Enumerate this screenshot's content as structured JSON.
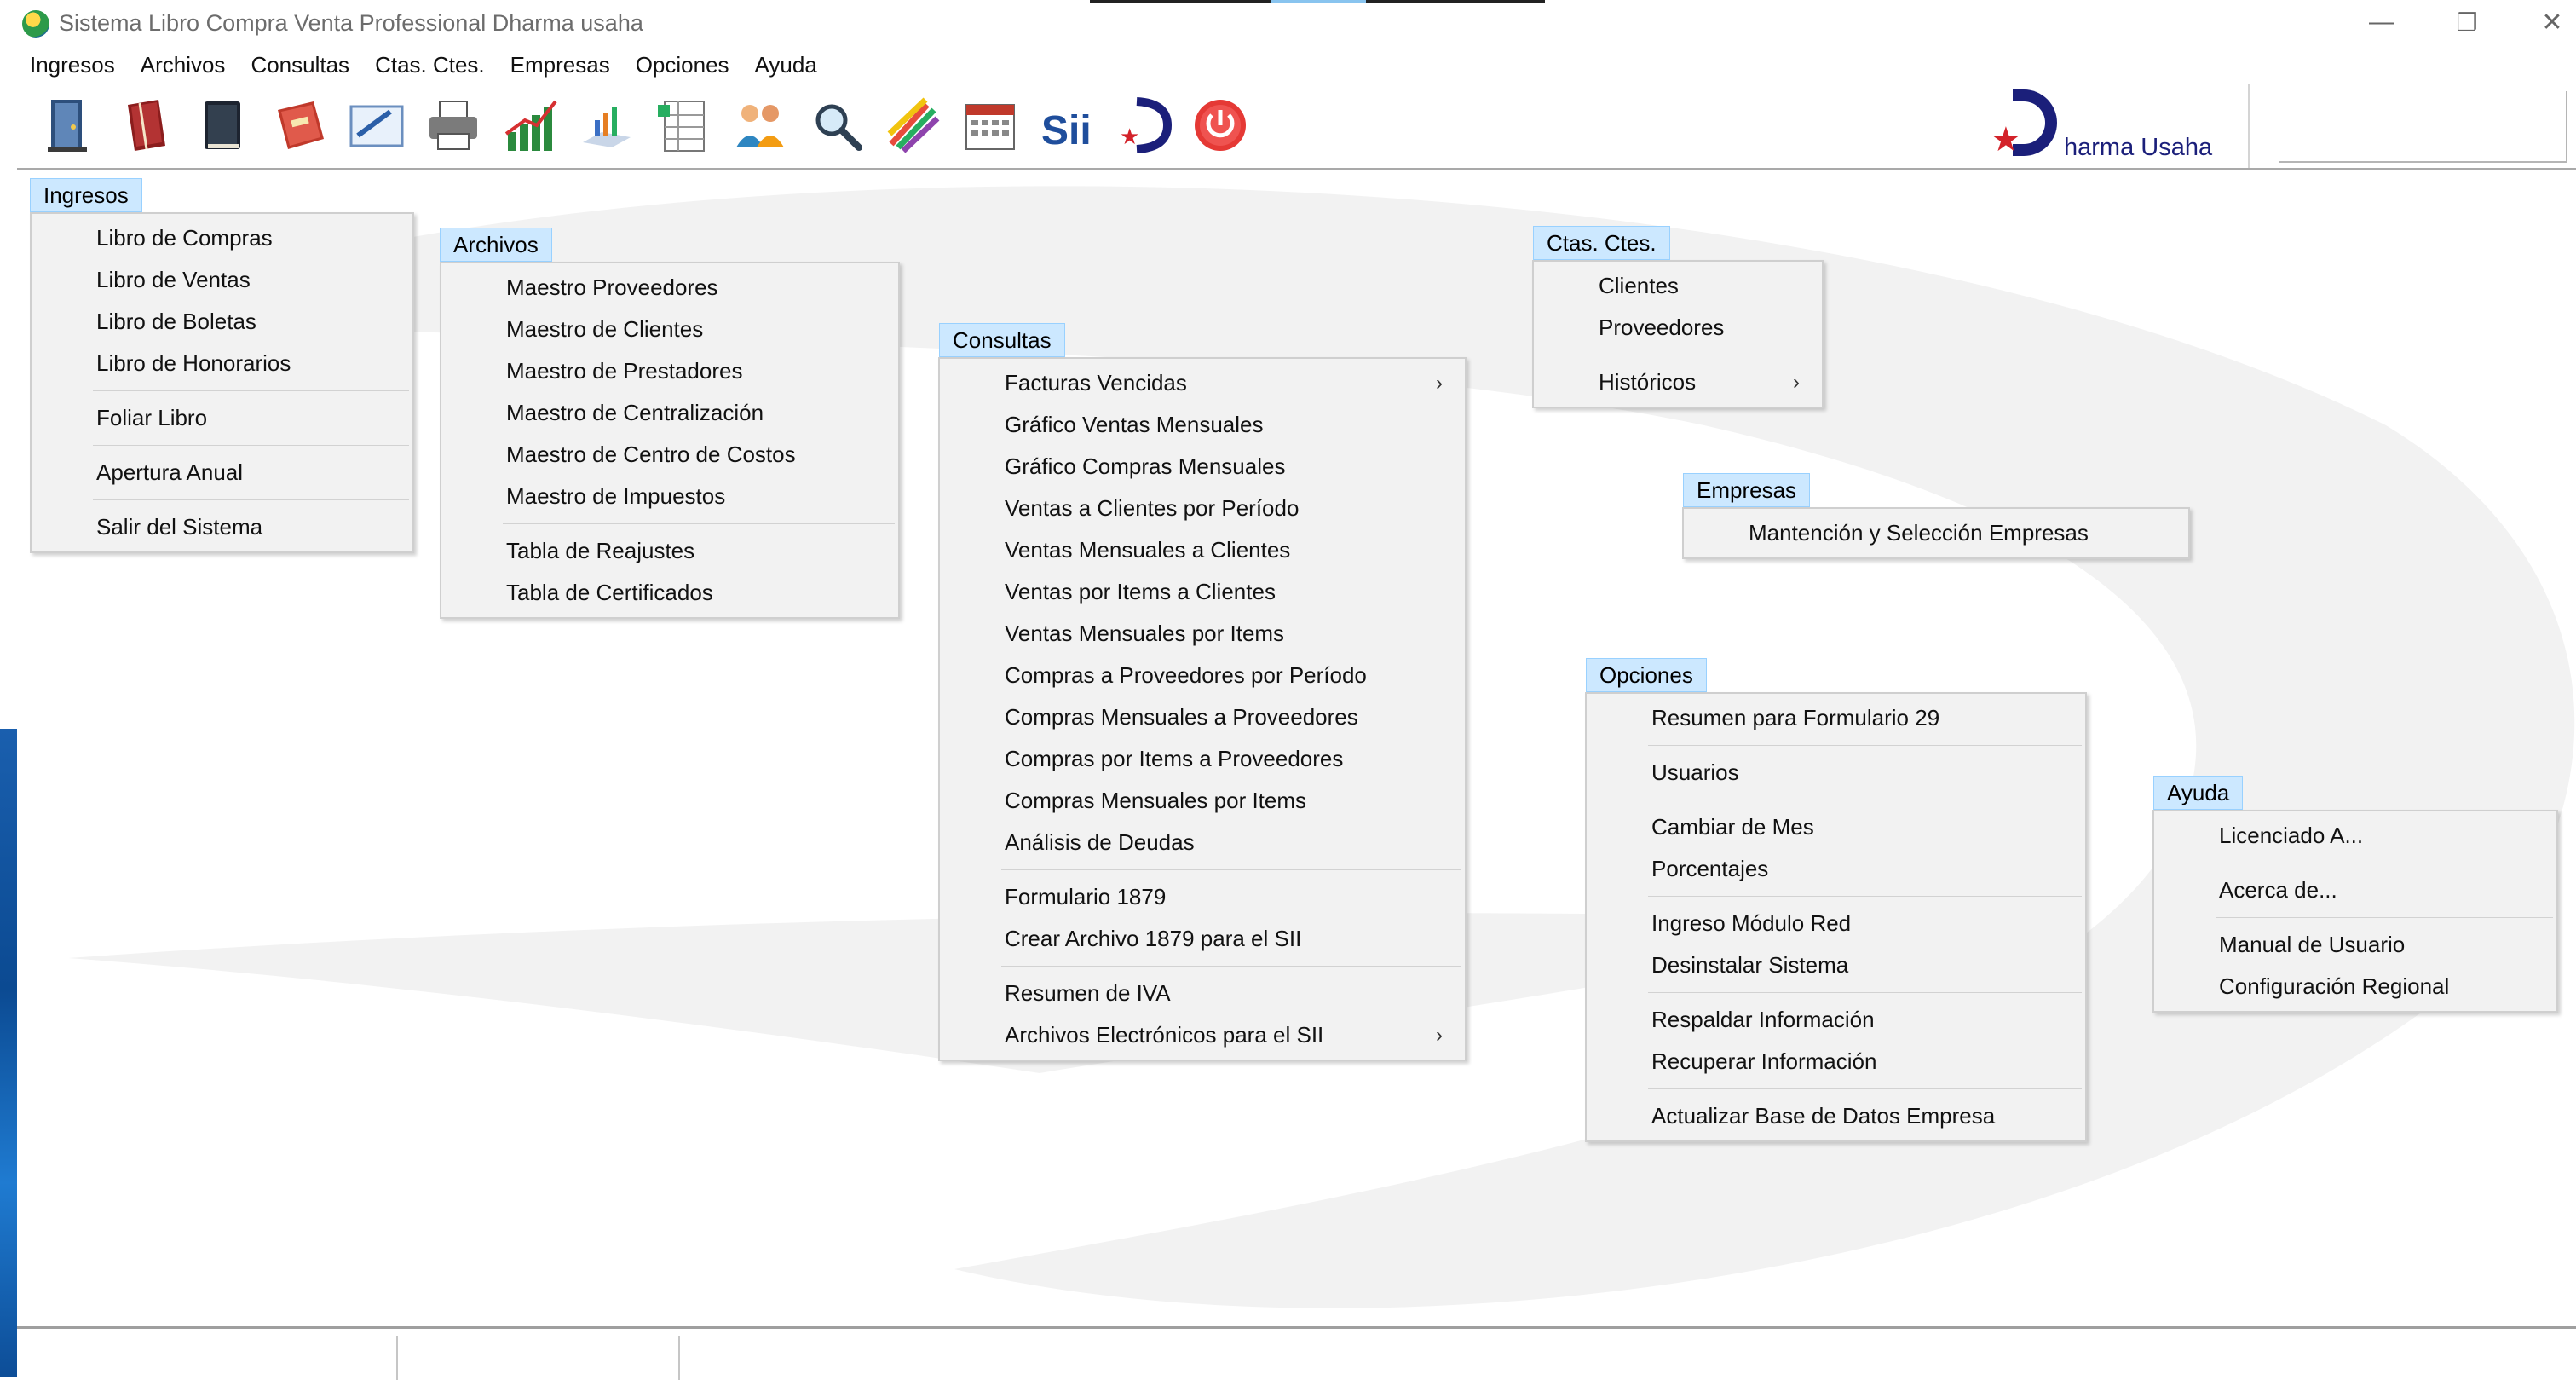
{
  "window": {
    "title": "Sistema Libro Compra Venta Professional Dharma usaha",
    "controls": {
      "minimize": "—",
      "restore": "❐",
      "close": "✕"
    }
  },
  "menubar": [
    "Ingresos",
    "Archivos",
    "Consultas",
    "Ctas. Ctes.",
    "Empresas",
    "Opciones",
    "Ayuda"
  ],
  "toolbar": {
    "icons": [
      "door-exit-icon",
      "red-book-icon",
      "black-book-icon",
      "red-ledger-icon",
      "pencil-form-icon",
      "printer-icon",
      "bar-chart-icon",
      "line-chart-icon",
      "spreadsheet-icon",
      "users-group-icon",
      "magnifier-icon",
      "colored-pencils-icon",
      "calendar-icon",
      "sii-logo-icon",
      "dharma-d-icon",
      "power-off-icon"
    ],
    "sii_label": "Sii",
    "brand_text": "harma Usaha",
    "brand_star": "★"
  },
  "menus": {
    "ingresos": {
      "title": "Ingresos",
      "groups": [
        [
          {
            "label": "Libro de Compras"
          },
          {
            "label": "Libro de Ventas"
          },
          {
            "label": "Libro de Boletas"
          },
          {
            "label": "Libro de Honorarios"
          }
        ],
        [
          {
            "label": "Foliar Libro"
          }
        ],
        [
          {
            "label": "Apertura Anual"
          }
        ],
        [
          {
            "label": "Salir del Sistema"
          }
        ]
      ]
    },
    "archivos": {
      "title": "Archivos",
      "groups": [
        [
          {
            "label": "Maestro Proveedores"
          },
          {
            "label": "Maestro de Clientes"
          },
          {
            "label": "Maestro de Prestadores"
          },
          {
            "label": "Maestro de Centralización"
          },
          {
            "label": "Maestro de Centro de Costos"
          },
          {
            "label": "Maestro de Impuestos"
          }
        ],
        [
          {
            "label": "Tabla de Reajustes"
          },
          {
            "label": "Tabla de Certificados"
          }
        ]
      ]
    },
    "consultas": {
      "title": "Consultas",
      "groups": [
        [
          {
            "label": "Facturas Vencidas",
            "arrow": "›"
          },
          {
            "label": "Gráfico Ventas Mensuales"
          },
          {
            "label": "Gráfico Compras Mensuales"
          },
          {
            "label": "Ventas a Clientes por Período"
          },
          {
            "label": "Ventas Mensuales a Clientes"
          },
          {
            "label": "Ventas por Items a Clientes"
          },
          {
            "label": "Ventas Mensuales por Items"
          },
          {
            "label": "Compras a Proveedores por Período"
          },
          {
            "label": "Compras Mensuales a Proveedores"
          },
          {
            "label": "Compras por Items a Proveedores"
          },
          {
            "label": "Compras Mensuales por Items"
          },
          {
            "label": "Análisis de Deudas"
          }
        ],
        [
          {
            "label": "Formulario 1879"
          },
          {
            "label": "Crear Archivo 1879 para el SII"
          }
        ],
        [
          {
            "label": "Resumen de IVA"
          },
          {
            "label": "Archivos Electrónicos para el SII",
            "arrow": "›"
          }
        ]
      ]
    },
    "ctas": {
      "title": "Ctas. Ctes.",
      "groups": [
        [
          {
            "label": "Clientes"
          },
          {
            "label": "Proveedores"
          }
        ],
        [
          {
            "label": "Históricos",
            "arrow": "›"
          }
        ]
      ]
    },
    "empresas": {
      "title": "Empresas",
      "groups": [
        [
          {
            "label": "Mantención y Selección Empresas"
          }
        ]
      ]
    },
    "opciones": {
      "title": "Opciones",
      "groups": [
        [
          {
            "label": "Resumen para Formulario 29"
          }
        ],
        [
          {
            "label": "Usuarios"
          }
        ],
        [
          {
            "label": "Cambiar de Mes"
          },
          {
            "label": "Porcentajes"
          }
        ],
        [
          {
            "label": "Ingreso Módulo Red"
          },
          {
            "label": "Desinstalar Sistema"
          }
        ],
        [
          {
            "label": "Respaldar Información"
          },
          {
            "label": "Recuperar Información"
          }
        ],
        [
          {
            "label": "Actualizar Base de Datos Empresa"
          }
        ]
      ]
    },
    "ayuda": {
      "title": "Ayuda",
      "groups": [
        [
          {
            "label": "Licenciado A..."
          }
        ],
        [
          {
            "label": "Acerca de..."
          }
        ],
        [
          {
            "label": "Manual de Usuario"
          },
          {
            "label": "Configuración Regional"
          }
        ]
      ]
    }
  }
}
